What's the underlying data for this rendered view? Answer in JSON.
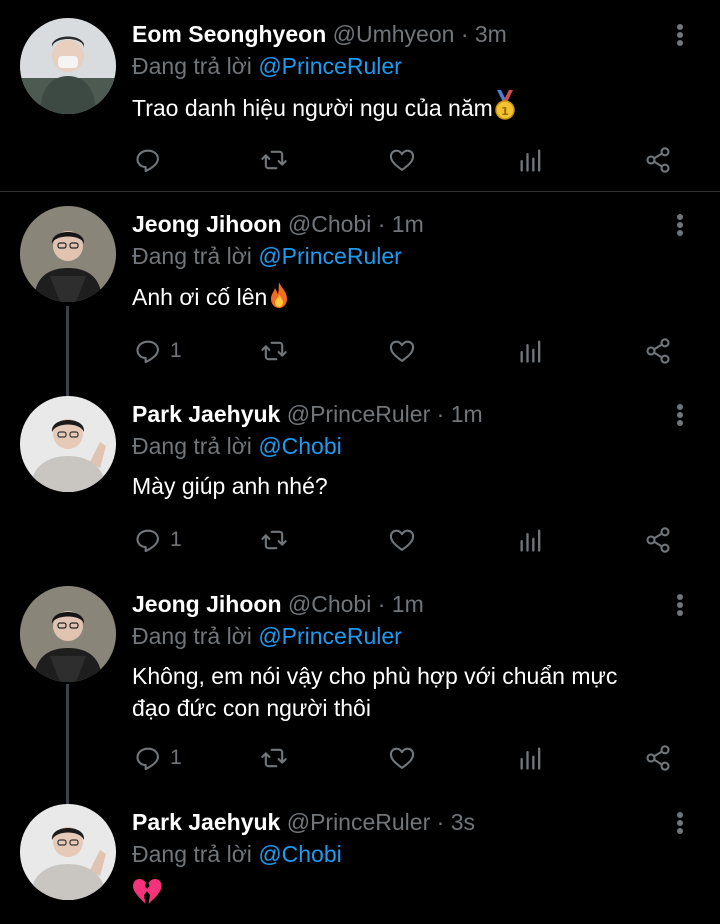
{
  "replying_prefix": "Đang trả lời",
  "tweets": [
    {
      "name": "Eom Seonghyeon",
      "handle": "@Umhyeon",
      "dot": "·",
      "time": "3m",
      "reply_to": "@PrinceRuler",
      "text": "Trao danh hiệu người ngu của năm",
      "emoji": "medal-icon",
      "reply_count": ""
    },
    {
      "name": "Jeong Jihoon",
      "handle": "@Chobi",
      "dot": "·",
      "time": "1m",
      "reply_to": "@PrinceRuler",
      "text": "Anh ơi cố lên",
      "emoji": "fire-icon",
      "reply_count": "1"
    },
    {
      "name": "Park Jaehyuk",
      "handle": "@PrinceRuler",
      "dot": "·",
      "time": "1m",
      "reply_to": "@Chobi",
      "text": "Mày giúp anh nhé?",
      "emoji": "",
      "reply_count": "1"
    },
    {
      "name": "Jeong Jihoon",
      "handle": "@Chobi",
      "dot": "·",
      "time": "1m",
      "reply_to": "@PrinceRuler",
      "text_line1": "Không, em nói vậy cho phù hợp với chuẩn mực",
      "text_line2": "đạo đức con người thôi",
      "emoji": "",
      "reply_count": "1"
    },
    {
      "name": "Park Jaehyuk",
      "handle": "@PrinceRuler",
      "dot": "·",
      "time": "3s",
      "reply_to": "@Chobi",
      "text": "",
      "emoji": "broken-heart-icon",
      "reply_count": ""
    }
  ],
  "colors": {
    "background": "#000000",
    "mention": "#1d9bf0",
    "muted": "#71767b",
    "thread_line": "#3b4147"
  }
}
